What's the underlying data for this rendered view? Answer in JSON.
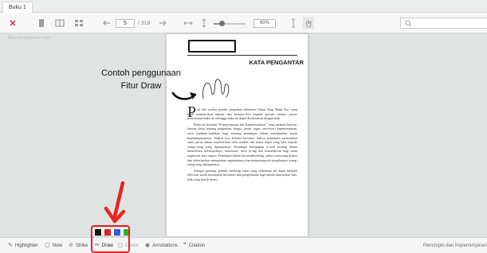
{
  "tabs": [
    {
      "label": "Buku 1"
    }
  ],
  "toolbar": {
    "close_glyph": "✕",
    "page_current": "5",
    "page_total": "/ 318",
    "zoom_percent": "60%",
    "zoom_level": 0.25,
    "icons": [
      "close-icon",
      "single-page-icon",
      "two-page-icon",
      "grid-icon",
      "arrow-left-icon",
      "arrow-right-icon",
      "fit-width-icon",
      "fit-height-icon",
      "text-cursor-icon",
      "hand-icon",
      "search-icon"
    ]
  },
  "sidebar": {
    "notice": "Buku ini disponsori oleh"
  },
  "page": {
    "chapter_title": "KATA PENGANTAR",
    "drop_cap": "P",
    "paragraphs": [
      "uji dan syukur penulis panjatkan kehadirat Tuhan Yang Maha Esa, yang telah memberikan rahmat dan karunia-Nya kepada penulis selama proses penyusunan buku ini sehingga buku ini dapat diselesaikan dengan baik.",
      "Buku ini berjudul \"Prinsip-prinsip dan Kepemimpinan\", yang memuat konsep-konsep dasar tentang pengertian, fungsi, peran, tugas, teori-teori kepemimpinan, serta tindakan-tindakan bagi seorang pemimpin dalam menjalankan peran kepemimpinannya. Seperti kita ketahui bersama, bahwa pemimpin memainkan suatu peran dalam memberikan nilai tambah dan mana dapat yang baik kepada orang-orang yang dipimpinnya. Pemimpin merupakan to-koh penting dalam memotivasi kelompoknya, komitmen, daya se-ing dan kemandirian bagi suatu organisasi atau negara. Pemimpin dalam hal membimbing, sukses seseorang diukur dari keberhasilan memajukan organisasinya dan mempengaruhi pengikutnya orang-orang yang dipimpinnya.",
      "Sebagai penutup, penulis berharap buku yang sederhana ini dapat menjadi referensi untuk menambah informasi dan pengetahuan bagi semua masyarakat luas, baik yang masih awam"
    ]
  },
  "annotation": {
    "caption_line1": "Contoh penggunaan",
    "caption_line2": "Fitur Draw"
  },
  "bottombar": {
    "items": [
      {
        "label": "Highlighter",
        "icon": "pen-icon"
      },
      {
        "label": "Note",
        "icon": "note-icon"
      },
      {
        "label": "Strike",
        "icon": "strike-icon"
      },
      {
        "label": "Draw",
        "icon": "pencil-icon"
      },
      {
        "label": "Eraser",
        "icon": "eraser-icon"
      },
      {
        "label": "Annotations",
        "icon": "eye-icon"
      },
      {
        "label": "Citation",
        "icon": "quote-icon"
      }
    ],
    "right_title": "Pemimpin dan Kepemimpinan",
    "palette_colors": [
      "#111111",
      "#e02020",
      "#2f5fd6",
      "#2fb23a"
    ]
  },
  "colors": {
    "accent_red": "#e8231f",
    "close_red": "#d0342c"
  }
}
